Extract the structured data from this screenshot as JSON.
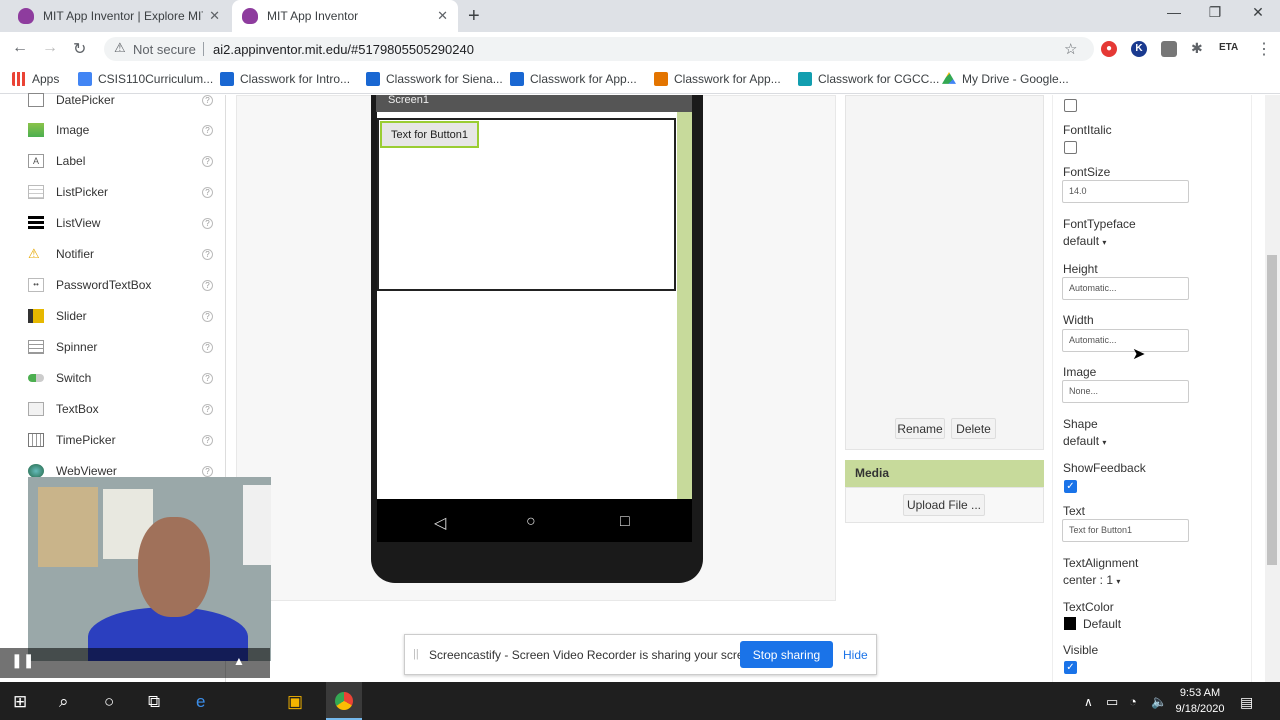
{
  "browser": {
    "tabs": [
      {
        "title": "MIT App Inventor | Explore MIT A"
      },
      {
        "title": "MIT App Inventor"
      }
    ],
    "not_secure": "Not secure",
    "url": "ai2.appinventor.mit.edu/#5179805505290240",
    "bookmarks": [
      {
        "label": "Apps",
        "color": "#4285f4"
      },
      {
        "label": "CSIS110Curriculum...",
        "color": "#4285f4"
      },
      {
        "label": "Classwork for Intro...",
        "color": "#1967d2"
      },
      {
        "label": "Classwork for Siena...",
        "color": "#1967d2"
      },
      {
        "label": "Classwork for App...",
        "color": "#1967d2"
      },
      {
        "label": "Classwork for App...",
        "color": "#e37400"
      },
      {
        "label": "Classwork for CGCC...",
        "color": "#129eaf"
      },
      {
        "label": "My Drive - Google...",
        "color": "#fbbc04"
      }
    ],
    "extensions": [
      "K",
      "ETA"
    ]
  },
  "palette": {
    "items": [
      {
        "label": "DatePicker",
        "icon": "datepicker-icon"
      },
      {
        "label": "Image",
        "icon": "image-icon"
      },
      {
        "label": "Label",
        "icon": "label-icon"
      },
      {
        "label": "ListPicker",
        "icon": "listpicker-icon"
      },
      {
        "label": "ListView",
        "icon": "listview-icon"
      },
      {
        "label": "Notifier",
        "icon": "notifier-icon"
      },
      {
        "label": "PasswordTextBox",
        "icon": "password-icon"
      },
      {
        "label": "Slider",
        "icon": "slider-icon"
      },
      {
        "label": "Spinner",
        "icon": "spinner-icon"
      },
      {
        "label": "Switch",
        "icon": "switch-icon"
      },
      {
        "label": "TextBox",
        "icon": "textbox-icon"
      },
      {
        "label": "TimePicker",
        "icon": "timepicker-icon"
      },
      {
        "label": "WebViewer",
        "icon": "webviewer-icon"
      }
    ],
    "help_glyph": "?"
  },
  "viewer": {
    "screen_title": "Screen1",
    "button_text": "Text for Button1"
  },
  "components": {
    "rename": "Rename",
    "delete": "Delete",
    "media_title": "Media",
    "upload": "Upload File ..."
  },
  "properties": {
    "fontitalic_label": "FontItalic",
    "fontsize_label": "FontSize",
    "fontsize_value": "14.0",
    "fonttypeface_label": "FontTypeface",
    "fonttypeface_value": "default",
    "height_label": "Height",
    "height_value": "Automatic...",
    "width_label": "Width",
    "width_value": "Automatic...",
    "image_label": "Image",
    "image_value": "None...",
    "shape_label": "Shape",
    "shape_value": "default",
    "showfeedback_label": "ShowFeedback",
    "text_label": "Text",
    "text_value": "Text for Button1",
    "textalignment_label": "TextAlignment",
    "textalignment_value": "center : 1",
    "textcolor_label": "TextColor",
    "textcolor_value": "Default",
    "visible_label": "Visible"
  },
  "screencastify": {
    "message": "Screencastify - Screen Video Recorder is sharing your screen.",
    "stop": "Stop sharing",
    "hide": "Hide"
  },
  "taskbar": {
    "time": "9:53 AM",
    "date": "9/18/2020"
  }
}
